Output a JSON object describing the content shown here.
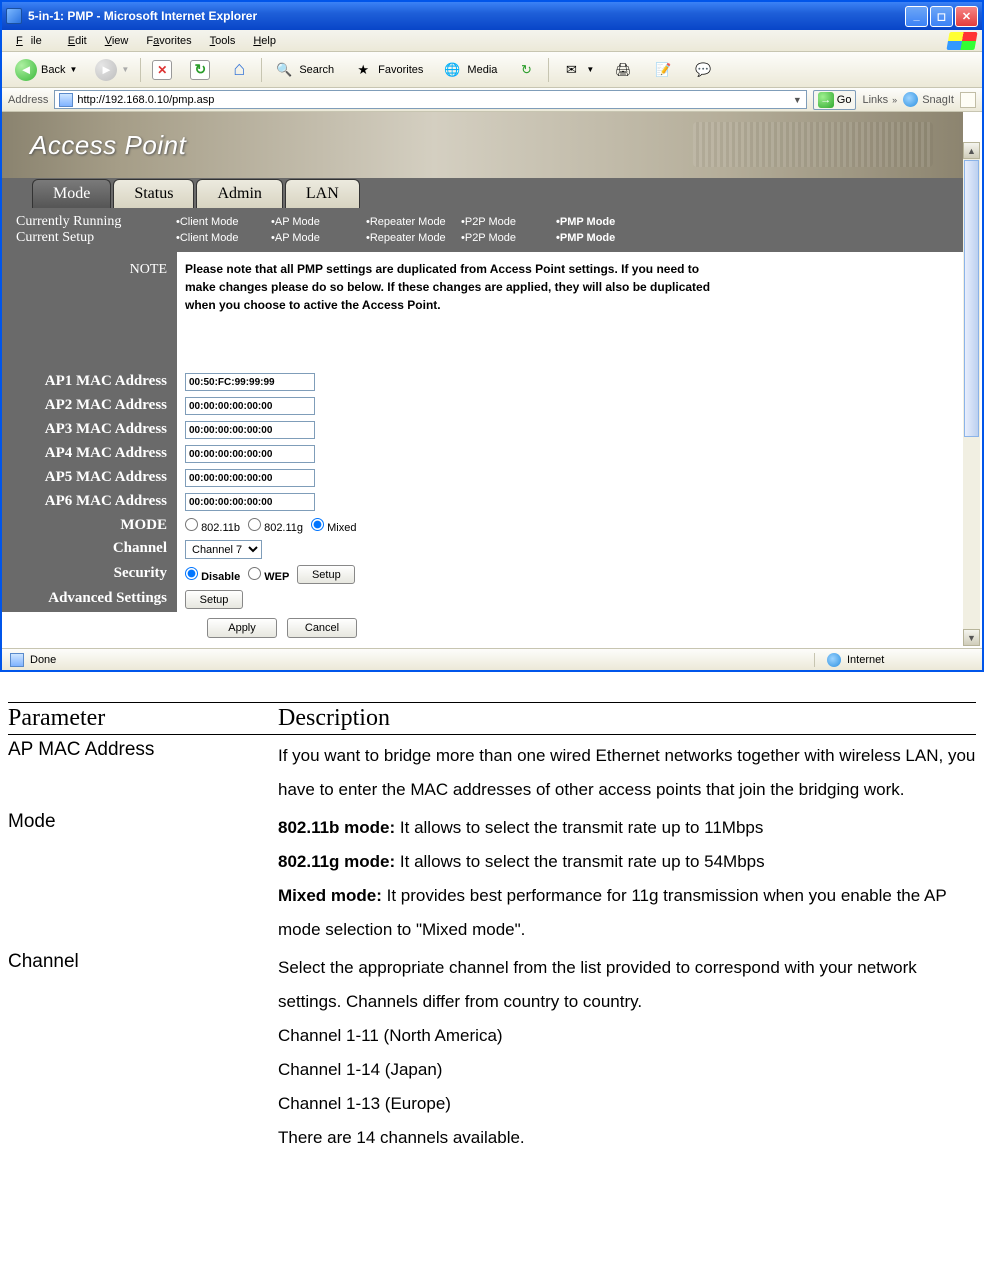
{
  "window": {
    "title": "5-in-1: PMP - Microsoft Internet Explorer"
  },
  "menu": {
    "file": "File",
    "edit": "Edit",
    "view": "View",
    "favorites": "Favorites",
    "tools": "Tools",
    "help": "Help"
  },
  "toolbar": {
    "back": "Back",
    "search": "Search",
    "favorites": "Favorites",
    "media": "Media"
  },
  "address": {
    "label": "Address",
    "url": "http://192.168.0.10/pmp.asp",
    "go": "Go",
    "links": "Links",
    "snagit": "SnagIt"
  },
  "page": {
    "banner_title": "Access Point",
    "tabs": {
      "mode": "Mode",
      "status": "Status",
      "admin": "Admin",
      "lan": "LAN"
    },
    "modes": {
      "running_label": "Currently Running",
      "setup_label": "Current Setup",
      "options": [
        "•Client Mode",
        "•AP Mode",
        "•Repeater Mode",
        "•P2P Mode",
        "•PMP Mode"
      ]
    },
    "note_label": "NOTE",
    "note_text": "Please note that all PMP settings are duplicated from Access Point settings. If you need to make changes please do so below. If these changes are applied, they will also be duplicated when you choose to active the Access Point.",
    "mac_labels": [
      "AP1 MAC Address",
      "AP2 MAC Address",
      "AP3 MAC Address",
      "AP4 MAC Address",
      "AP5 MAC Address",
      "AP6 MAC Address"
    ],
    "mac_values": [
      "00:50:FC:99:99:99",
      "00:00:00:00:00:00",
      "00:00:00:00:00:00",
      "00:00:00:00:00:00",
      "00:00:00:00:00:00",
      "00:00:00:00:00:00"
    ],
    "mode_label": "MODE",
    "mode_opts": {
      "b": "802.11b",
      "g": "802.11g",
      "mixed": "Mixed"
    },
    "channel_label": "Channel",
    "channel_value": "Channel 7",
    "security_label": "Security",
    "security_opts": {
      "disable": "Disable",
      "wep": "WEP"
    },
    "setup_btn": "Setup",
    "advanced_label": "Advanced Settings",
    "apply": "Apply",
    "cancel": "Cancel"
  },
  "status": {
    "done": "Done",
    "zone": "Internet"
  },
  "params": {
    "head_param": "Parameter",
    "head_desc": "Description",
    "rows": [
      {
        "name": "AP MAC Address",
        "desc": "If you want to bridge more than one wired Ethernet networks together with wireless LAN, you have to enter the MAC addresses of other access points that join the bridging work."
      },
      {
        "name": "Mode",
        "desc_parts": [
          {
            "b": "802.11b mode:",
            "t": " It allows to select the transmit rate up to 11Mbps"
          },
          {
            "b": "802.11g mode:",
            "t": " It allows to select the transmit rate up to 54Mbps"
          },
          {
            "b": "Mixed mode:",
            "t": " It provides best performance for 11g transmission when you enable the AP mode selection to \"Mixed mode\"."
          }
        ]
      },
      {
        "name": "Channel",
        "desc_lines": [
          "Select the appropriate channel from the list provided to correspond with your network settings. Channels differ from country to country.",
          "Channel 1-11 (North America)",
          "Channel 1-14 (Japan)",
          "Channel 1-13 (Europe)",
          "There are 14 channels available."
        ]
      }
    ]
  }
}
